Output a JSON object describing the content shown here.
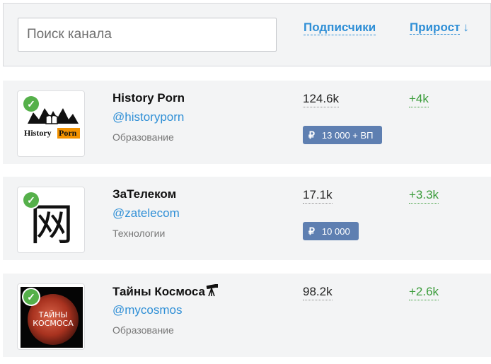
{
  "search": {
    "placeholder": "Поиск канала"
  },
  "columns": {
    "subscribers": "Подписчики",
    "growth": "Прирост",
    "sort_arrow": "↓"
  },
  "channels": [
    {
      "name": "History Porn",
      "handle": "@historyporn",
      "category": "Образование",
      "subscribers": "124.6k",
      "growth": "+4k",
      "price": "13 000 + ВП",
      "currency": "₽",
      "verified": true,
      "logo": {
        "word1": "History",
        "word2": "Porn"
      }
    },
    {
      "name": "ЗаТелеком",
      "handle": "@zatelecom",
      "category": "Технологии",
      "subscribers": "17.1k",
      "growth": "+3.3k",
      "price": "10 000",
      "currency": "₽",
      "verified": true,
      "logo": {
        "glyph": "网"
      }
    },
    {
      "name": "Тайны Космоса",
      "handle": "@mycosmos",
      "category": "Образование",
      "subscribers": "98.2k",
      "growth": "+2.6k",
      "verified": true,
      "name_icon": "telescope-icon",
      "logo": {
        "line1": "ТАЙНЫ",
        "line2": "КОСМОСА"
      }
    }
  ],
  "colors": {
    "link": "#2f8fd6",
    "growth": "#3a9c3a",
    "price_badge": "#5e7fb1",
    "verified": "#55b04a"
  }
}
